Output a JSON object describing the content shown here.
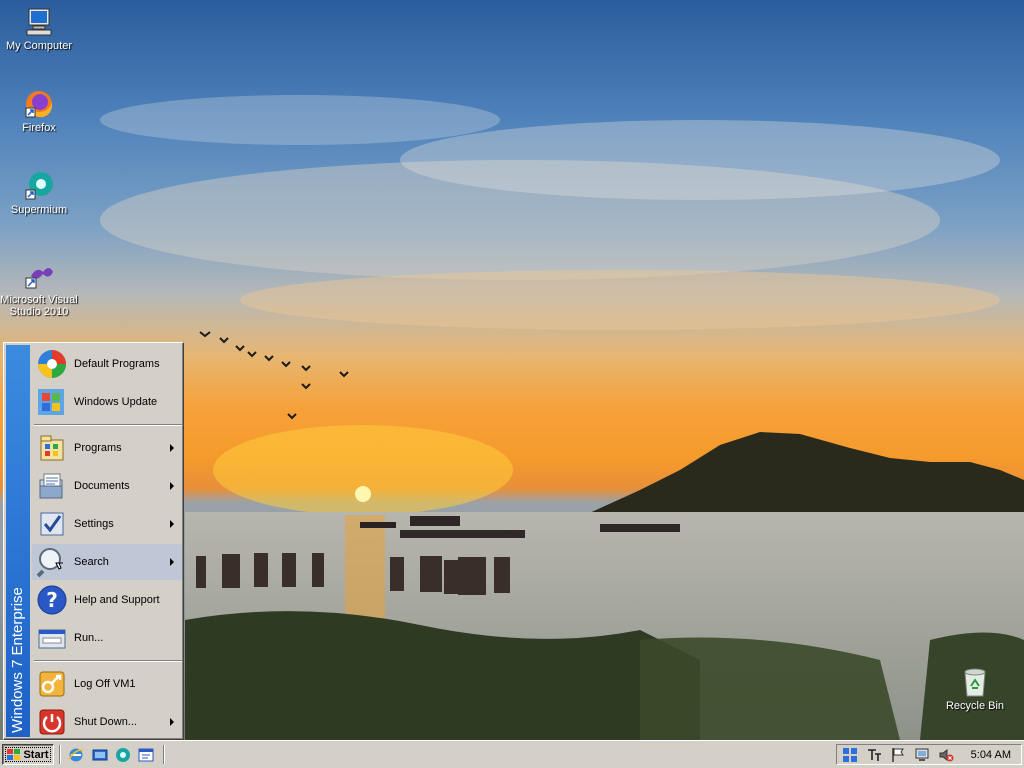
{
  "desktop": {
    "icons": [
      {
        "label": "My Computer",
        "icon": "my-computer-icon"
      },
      {
        "label": "Firefox",
        "icon": "firefox-icon"
      },
      {
        "label": "Supermium",
        "icon": "supermium-icon"
      },
      {
        "label": "Microsoft Visual Studio 2010",
        "icon": "visual-studio-icon"
      },
      {
        "label": "Recycle Bin",
        "icon": "recycle-bin-icon"
      }
    ]
  },
  "start_menu": {
    "banner": "Windows 7 Enterprise",
    "items": [
      {
        "label": "Default Programs",
        "icon": "default-programs-icon"
      },
      {
        "label": "Windows Update",
        "icon": "windows-update-icon"
      },
      {
        "label": "Programs",
        "icon": "programs-icon",
        "submenu": true
      },
      {
        "label": "Documents",
        "icon": "documents-icon",
        "submenu": true
      },
      {
        "label": "Settings",
        "icon": "settings-icon",
        "submenu": true
      },
      {
        "label": "Search",
        "icon": "search-icon",
        "submenu": true,
        "highlighted": true
      },
      {
        "label": "Help and Support",
        "icon": "help-icon"
      },
      {
        "label": "Run...",
        "icon": "run-icon"
      },
      {
        "label": "Log Off VM1",
        "icon": "log-off-icon"
      },
      {
        "label": "Shut Down...",
        "icon": "shut-down-icon",
        "submenu": true
      }
    ]
  },
  "taskbar": {
    "start_label": "Start",
    "quick_launch": [
      "internet-explorer-icon",
      "show-desktop-icon",
      "supermium-icon",
      "explorer-window-icon"
    ],
    "tray_icons": [
      "windows-logo-icon",
      "input-method-icon",
      "flag-icon",
      "network-icon",
      "volume-muted-icon"
    ],
    "clock": "5:04 AM"
  },
  "colors": {
    "banner": "#1d61c6",
    "face": "#d4d0c8",
    "highlight": "#bfc6d6"
  }
}
